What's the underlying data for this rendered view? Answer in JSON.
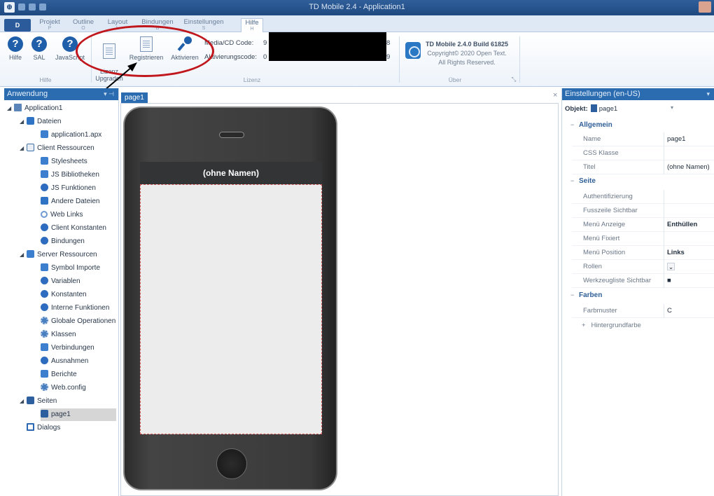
{
  "window": {
    "title": "TD Mobile 2.4 - Application1",
    "app_icon": "⊕"
  },
  "ribbon_tabs": [
    {
      "label": "D",
      "key": ""
    },
    {
      "label": "Projekt",
      "key": "P"
    },
    {
      "label": "Outline",
      "key": "O"
    },
    {
      "label": "Layout",
      "key": "L"
    },
    {
      "label": "Bindungen",
      "key": "B"
    },
    {
      "label": "Einstellungen",
      "key": "S"
    },
    {
      "label": "Hilfe",
      "key": "H"
    }
  ],
  "ribbon": {
    "help_group": {
      "label": "Hilfe",
      "buttons": [
        {
          "label": "Hilfe",
          "icon": "help-icon"
        },
        {
          "label": "SAL",
          "icon": "help-icon"
        },
        {
          "label": "JavaScript",
          "icon": "help-icon"
        }
      ]
    },
    "license_group": {
      "label": "Lizenz",
      "buttons": [
        {
          "label": "Lizenz\nUpgraden",
          "icon": "license-upgrade-icon"
        },
        {
          "label": "Registrieren",
          "icon": "register-icon"
        },
        {
          "label": "Aktivieren",
          "icon": "key-icon"
        }
      ],
      "media_code_label": "Media/CD Code:",
      "media_code_prefix": "9",
      "media_code_suffix": "8",
      "activation_code_label": "Aktivierungscode:",
      "activation_code_prefix": "0",
      "activation_code_suffix": "9"
    },
    "about_group": {
      "label": "Über",
      "product": "TD Mobile 2.4.0  Build 61825",
      "copyright": "Copyright© 2020 Open Text.",
      "rights": "All Rights Reserved."
    }
  },
  "left_panel": {
    "title": "Anwendung",
    "pin": "▾ ⊣",
    "tree": [
      {
        "label": "Application1",
        "expanded": true
      },
      {
        "label": "Dateien",
        "expanded": true
      },
      {
        "label": "application1.apx"
      },
      {
        "label": "Client Ressourcen",
        "expanded": true
      },
      {
        "label": "Stylesheets"
      },
      {
        "label": "JS Bibliotheken"
      },
      {
        "label": "JS Funktionen"
      },
      {
        "label": "Andere Dateien"
      },
      {
        "label": "Web Links"
      },
      {
        "label": "Client Konstanten"
      },
      {
        "label": "Bindungen"
      },
      {
        "label": "Server Ressourcen",
        "expanded": true
      },
      {
        "label": "Symbol Importe"
      },
      {
        "label": "Variablen"
      },
      {
        "label": "Konstanten"
      },
      {
        "label": "Interne Funktionen"
      },
      {
        "label": "Globale Operationen"
      },
      {
        "label": "Klassen"
      },
      {
        "label": "Verbindungen"
      },
      {
        "label": "Ausnahmen"
      },
      {
        "label": "Berichte"
      },
      {
        "label": "Web.config"
      },
      {
        "label": "Seiten",
        "expanded": true
      },
      {
        "label": "page1",
        "selected": true
      },
      {
        "label": "Dialogs"
      }
    ]
  },
  "editor": {
    "tab_label": "page1",
    "close": "×",
    "phone_title": "(ohne Namen)"
  },
  "right_panel": {
    "title": "Einstellungen (en-US)",
    "object_label": "Objekt:",
    "object_value": "page1",
    "sections": {
      "allgemein": {
        "label": "Allgemein",
        "rows": [
          {
            "label": "Name",
            "value": "page1"
          },
          {
            "label": "CSS Klasse",
            "value": ""
          },
          {
            "label": "Titel",
            "value": "(ohne Namen)"
          }
        ]
      },
      "seite": {
        "label": "Seite",
        "rows": [
          {
            "label": "Authentifizierung",
            "value": ""
          },
          {
            "label": "Fusszeile Sichtbar",
            "value": ""
          },
          {
            "label": "Menü Anzeige",
            "value": "Enthüllen"
          },
          {
            "label": "Menü Fixiert",
            "value": ""
          },
          {
            "label": "Menü Position",
            "value": "Links"
          },
          {
            "label": "Rollen",
            "value": "⌄"
          },
          {
            "label": "Werkzeugliste Sichtbar",
            "value": "■"
          }
        ]
      },
      "farben": {
        "label": "Farben",
        "rows": [
          {
            "label": "Farbmuster",
            "value": "C"
          }
        ],
        "extra": "Hintergrundfarbe",
        "extra_prefix": "+"
      }
    }
  },
  "colors": {
    "accent": "#2b6cb0",
    "annotation": "#c0171d"
  }
}
